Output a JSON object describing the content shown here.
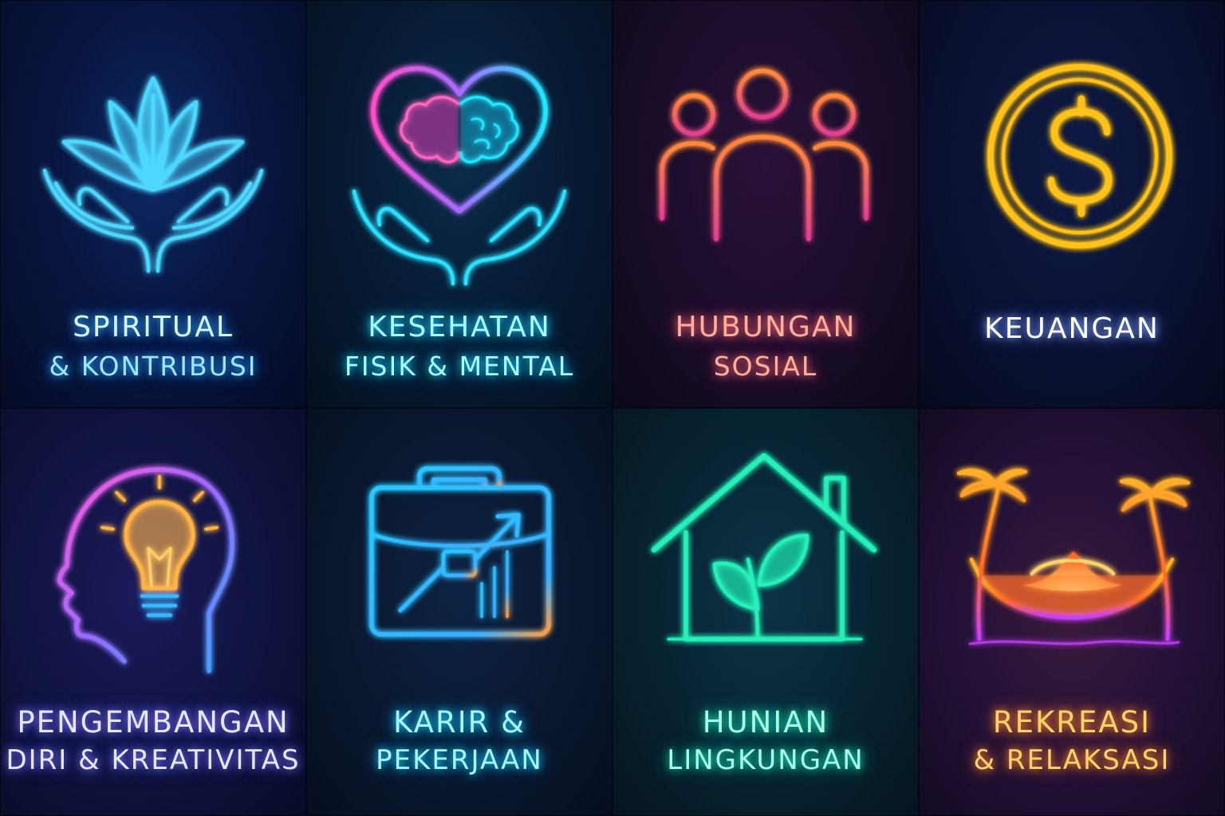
{
  "tiles": [
    {
      "line1": "SPIRITUAL",
      "line2": "& KONTRIBUSI",
      "icon": "lotus-in-hands-icon",
      "color": "#3ad6ff"
    },
    {
      "line1": "KESEHATAN",
      "line2": "FISIK & MENTAL",
      "icon": "heart-brain-in-hands-icon",
      "color": "#27e2ff"
    },
    {
      "line1": "HUBUNGAN",
      "line2": "SOSIAL",
      "icon": "people-group-icon",
      "color": "#ff7a4d"
    },
    {
      "line1": "KEUANGAN",
      "line2": "",
      "icon": "dollar-coin-icon",
      "color": "#ffc21a"
    },
    {
      "line1": "PENGEMBANGAN",
      "line2": "DIRI & KREATIVITAS",
      "icon": "head-lightbulb-icon",
      "color": "#b26bff"
    },
    {
      "line1": "KARIR &",
      "line2": "PEKERJAAN",
      "icon": "briefcase-growth-icon",
      "color": "#2cc8ff"
    },
    {
      "line1": "HUNIAN",
      "line2": "LINGKUNGAN",
      "icon": "house-sprout-icon",
      "color": "#25f0b8"
    },
    {
      "line1": "REKREASI",
      "line2": "& RELAKSASI",
      "icon": "hammock-palms-sunset-icon",
      "color": "#ff9a2b"
    }
  ]
}
